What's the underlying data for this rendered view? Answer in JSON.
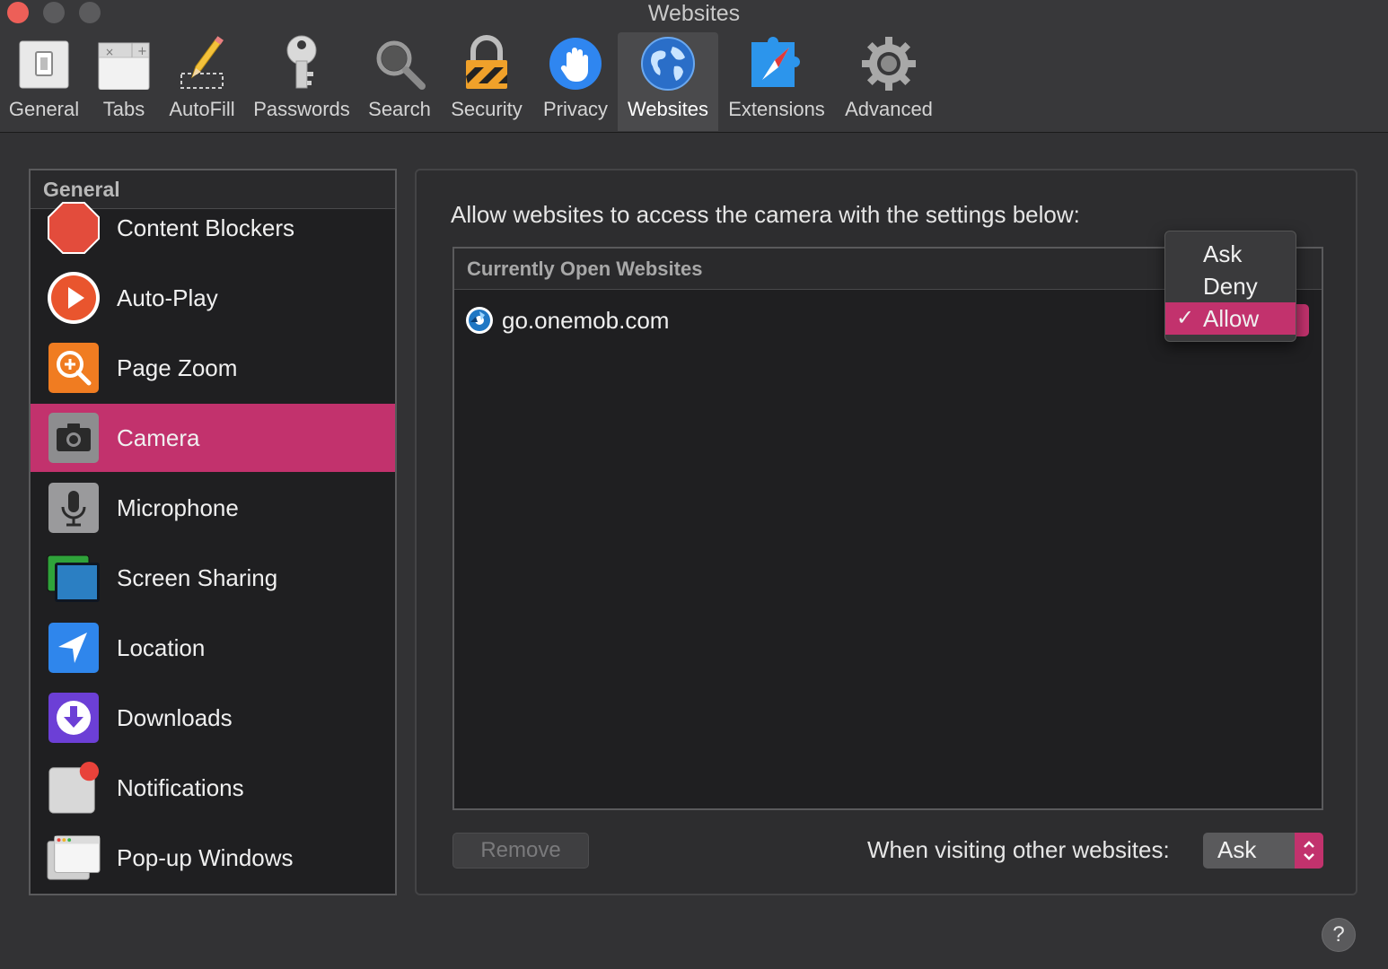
{
  "window": {
    "title": "Websites"
  },
  "toolbar": {
    "items": [
      {
        "label": "General",
        "icon": "switch-icon"
      },
      {
        "label": "Tabs",
        "icon": "tabs-icon"
      },
      {
        "label": "AutoFill",
        "icon": "pencil-icon"
      },
      {
        "label": "Passwords",
        "icon": "key-icon"
      },
      {
        "label": "Search",
        "icon": "magnifier-icon"
      },
      {
        "label": "Security",
        "icon": "lock-icon"
      },
      {
        "label": "Privacy",
        "icon": "hand-icon"
      },
      {
        "label": "Websites",
        "icon": "globe-icon",
        "active": true
      },
      {
        "label": "Extensions",
        "icon": "puzzle-icon"
      },
      {
        "label": "Advanced",
        "icon": "gear-icon"
      }
    ]
  },
  "sidebar": {
    "header": "General",
    "items": [
      {
        "label": "Content Blockers",
        "icon": "stop-sign-icon"
      },
      {
        "label": "Auto-Play",
        "icon": "play-icon"
      },
      {
        "label": "Page Zoom",
        "icon": "zoom-icon"
      },
      {
        "label": "Camera",
        "icon": "camera-icon",
        "selected": true
      },
      {
        "label": "Microphone",
        "icon": "microphone-icon"
      },
      {
        "label": "Screen Sharing",
        "icon": "screen-sharing-icon"
      },
      {
        "label": "Location",
        "icon": "location-arrow-icon"
      },
      {
        "label": "Downloads",
        "icon": "download-icon"
      },
      {
        "label": "Notifications",
        "icon": "notification-icon"
      },
      {
        "label": "Pop-up Windows",
        "icon": "popup-window-icon"
      }
    ]
  },
  "main": {
    "description": "Allow websites to access the camera with the settings below:",
    "table_header": "Currently Open Websites",
    "sites": [
      {
        "name": "go.onemob.com",
        "setting": "Allow"
      }
    ],
    "remove_label": "Remove",
    "other_label": "When visiting other websites:",
    "other_value": "Ask"
  },
  "menu": {
    "options": [
      "Ask",
      "Deny",
      "Allow"
    ],
    "selected": "Allow",
    "check": "✓"
  },
  "help": "?",
  "colors": {
    "accent": "#c2326d",
    "background": "#323234",
    "close": "#ed5f58"
  }
}
